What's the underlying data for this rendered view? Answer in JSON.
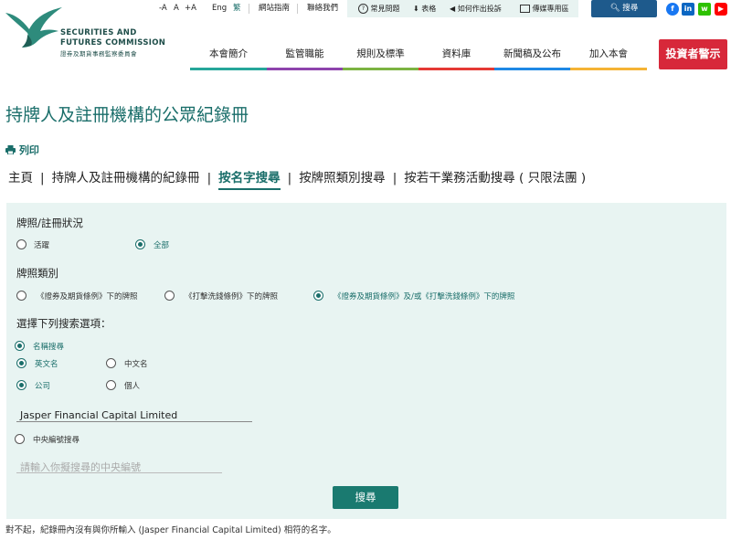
{
  "header": {
    "logo_line1": "SECURITIES AND",
    "logo_line2": "FUTURES COMMISSION",
    "logo_line3": "證券及期貨事務監察委員會",
    "font_small": "-A",
    "font_medium": "A",
    "font_large": "+A",
    "lang_en": "Eng",
    "lang_tc": "繁",
    "sitemap": "網站指南",
    "contact": "聯絡我們",
    "faq": "常見問題",
    "forms": "表格",
    "complaint": "如何作出投訴",
    "media": "傳媒專用區",
    "search": "搜尋",
    "social": [
      "f",
      "in",
      "w",
      "▶"
    ]
  },
  "nav": {
    "items": [
      {
        "label": "本會簡介",
        "color": "#26a69a"
      },
      {
        "label": "監管職能",
        "color": "#8e44ad"
      },
      {
        "label": "規則及標準",
        "color": "#7cb342"
      },
      {
        "label": "資料庫",
        "color": "#e53935"
      },
      {
        "label": "新聞稿及公布",
        "color": "#1e88e5"
      },
      {
        "label": "加入本會",
        "color": "#f5b335"
      }
    ],
    "alert_button": "投資者警示"
  },
  "page": {
    "title": "持牌人及註冊機構的公眾紀錄冊",
    "print": "列印",
    "breadcrumbs": [
      {
        "label": "主頁",
        "active": false
      },
      {
        "label": "持牌人及註冊機構的紀錄冊",
        "active": false
      },
      {
        "label": "按名字搜尋",
        "active": true
      },
      {
        "label": "按牌照類別搜尋",
        "active": false
      },
      {
        "label": "按若干業務活動搜尋 ( 只限法團 )",
        "active": false
      }
    ]
  },
  "form": {
    "status_title": "牌照/註冊狀況",
    "status_active": "活躍",
    "status_all": "全部",
    "type_title": "牌照類別",
    "type_sfo": "《證券及期貨條例》下的牌照",
    "type_amlo": "《打擊洗錢條例》下的牌照",
    "type_both": "《證券及期貨條例》及/或《打擊洗錢條例》下的牌照",
    "options_title": "選擇下列搜索選項：",
    "name_search": "名稱搜尋",
    "english_name": "英文名",
    "chinese_name": "中文名",
    "company": "公司",
    "individual": "個人",
    "name_value": "Jasper Financial Capital Limited",
    "ce_search": "中央編號搜尋",
    "ce_placeholder": "請輸入你擬搜尋的中央編號",
    "submit": "搜尋"
  },
  "result": {
    "message": "對不起，紀錄冊內沒有與你所輸入 (Jasper Financial Capital Limited) 相符的名字。"
  }
}
